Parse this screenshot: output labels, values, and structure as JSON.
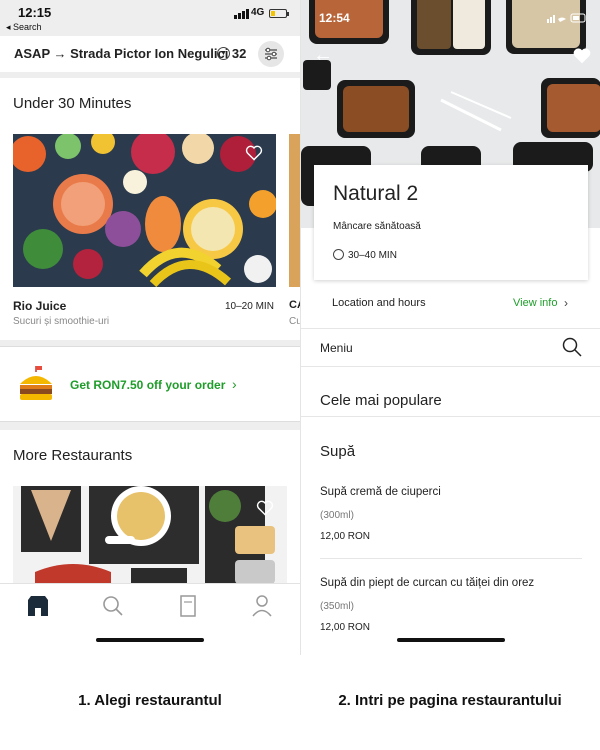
{
  "left": {
    "status": {
      "time": "12:15",
      "back_label": "◂ Search",
      "network": "4G"
    },
    "address": "ASAP → Strada Pictor Ion Negulici 32",
    "under30": {
      "title": "Under 30 Minutes",
      "restaurant": {
        "name": "Rio Juice",
        "subtitle": "Sucuri și smoothie-uri",
        "time": "10–20 MIN"
      },
      "peek": {
        "name": "CA",
        "subtitle": "Cu"
      }
    },
    "promo": {
      "text": "Get RON7.50 off your order",
      "arrow": "›"
    },
    "more": {
      "title": "More Restaurants"
    },
    "tabs": [
      "home-icon",
      "search-icon",
      "orders-icon",
      "account-icon"
    ]
  },
  "right": {
    "status": {
      "time": "12:54"
    },
    "restaurant": {
      "name": "Natural 2",
      "cuisine": "Mâncare sănătoasă",
      "eta": "30–40 MIN"
    },
    "location": {
      "label": "Location and hours",
      "view_info": "View info",
      "chevron": "›"
    },
    "menu_label": "Meniu",
    "popular_title": "Cele mai populare",
    "category": "Supă",
    "items": [
      {
        "name": "Supă cremă de ciuperci",
        "desc": "(300ml)",
        "price": "12,00 RON"
      },
      {
        "name": "Supă din piept de curcan cu tăiței din orez",
        "desc": "(350ml)",
        "price": "12,00 RON"
      }
    ]
  },
  "captions": [
    "1. Alegi restaurantul",
    "2. Intri pe pagina restaurantului"
  ],
  "colors": {
    "accent_green": "#1f9d2a",
    "promo_burger_yellow": "#f5b800"
  }
}
